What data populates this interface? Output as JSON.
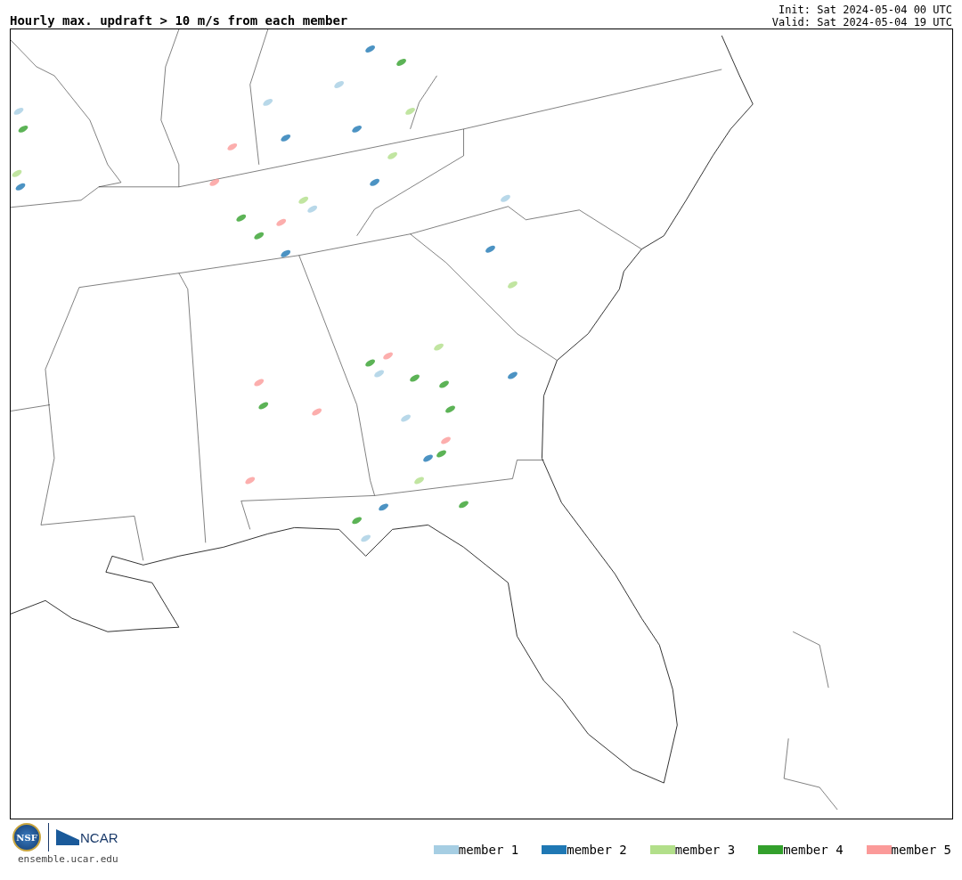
{
  "title": "Hourly max. updraft > 10 m/s from each member",
  "init": "Init: Sat 2024-05-04 00 UTC",
  "valid": "Valid: Sat 2024-05-04 19 UTC",
  "footer": {
    "nsf_logo_text": "NSF",
    "ncar_logo_text": "NCAR",
    "website": "ensemble.ucar.edu"
  },
  "legend": [
    {
      "label": "member 1",
      "color": "#a6cee3"
    },
    {
      "label": "member 2",
      "color": "#1f78b4"
    },
    {
      "label": "member 3",
      "color": "#b2df8a"
    },
    {
      "label": "member 4",
      "color": "#33a02c"
    },
    {
      "label": "member 5",
      "color": "#fb9a99"
    }
  ]
}
